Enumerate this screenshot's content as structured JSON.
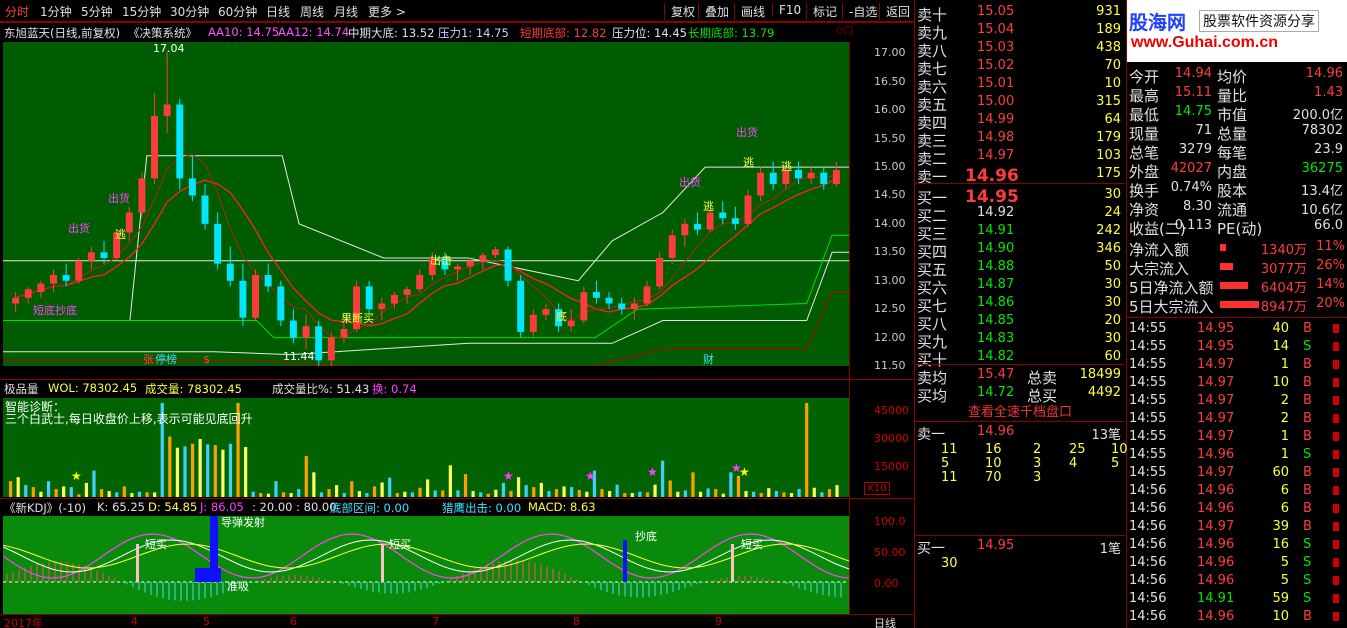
{
  "colors": {
    "up": "#ff3c3c",
    "down": "#00e6ff",
    "ma10": "#ffffff",
    "ma12": "#ff2020",
    "chart_bg": "#005c00",
    "vol_bg": "#006200",
    "kdj_bg": "#0a8a0a"
  },
  "toolbar": {
    "tabs": [
      "分时",
      "1分钟",
      "5分钟",
      "15分钟",
      "30分钟",
      "60分钟",
      "日线",
      "周线",
      "月线",
      "更多 >"
    ],
    "right": [
      "复权",
      "叠加",
      "画线",
      "F10",
      "标记",
      "-自选",
      "返回"
    ]
  },
  "info": {
    "stock": "东旭蓝天(日线,前复权)",
    "system": "《决策系统》",
    "ma10": "AA10: 14.75",
    "ma12": "AA12: 14.74",
    "mid_bottom": "中期大底: 13.52",
    "pressure": "压力1: 14.75",
    "short_bottom": "短期底部: 12.82",
    "pressure_level": "压力位: 14.45",
    "long_bottom": "长期底部: 13.79"
  },
  "chart_data": {
    "type": "candlestick",
    "yaxis_ticks": [
      "17.00",
      "16.50",
      "16.00",
      "15.50",
      "15.00",
      "14.50",
      "14.00",
      "13.50",
      "13.00",
      "12.50",
      "12.00",
      "11.50"
    ],
    "ylim": [
      11.5,
      17.2
    ],
    "annotations": [
      "17.04",
      "11.44",
      "出货",
      "出货",
      "出货",
      "出货",
      "逃",
      "逃",
      "逃",
      "逃",
      "出击",
      "底",
      "果断买",
      "短底抄底"
    ],
    "markers": [
      "张",
      "停榜",
      "$",
      "财"
    ],
    "candles": [
      {
        "o": 12.6,
        "h": 12.8,
        "l": 12.45,
        "c": 12.7
      },
      {
        "o": 12.7,
        "h": 12.9,
        "l": 12.6,
        "c": 12.85
      },
      {
        "o": 12.8,
        "h": 13.0,
        "l": 12.7,
        "c": 12.95
      },
      {
        "o": 12.95,
        "h": 13.2,
        "l": 12.8,
        "c": 13.1
      },
      {
        "o": 13.1,
        "h": 13.3,
        "l": 12.9,
        "c": 13.0
      },
      {
        "o": 13.0,
        "h": 13.4,
        "l": 12.95,
        "c": 13.35
      },
      {
        "o": 13.35,
        "h": 13.6,
        "l": 13.2,
        "c": 13.5
      },
      {
        "o": 13.5,
        "h": 13.7,
        "l": 13.3,
        "c": 13.4
      },
      {
        "o": 13.4,
        "h": 13.9,
        "l": 13.35,
        "c": 13.85
      },
      {
        "o": 13.85,
        "h": 14.3,
        "l": 13.7,
        "c": 14.2
      },
      {
        "o": 14.2,
        "h": 14.9,
        "l": 14.1,
        "c": 14.8
      },
      {
        "o": 14.8,
        "h": 16.3,
        "l": 14.7,
        "c": 15.9
      },
      {
        "o": 15.9,
        "h": 17.04,
        "l": 15.6,
        "c": 16.1
      },
      {
        "o": 16.1,
        "h": 16.2,
        "l": 14.6,
        "c": 14.8
      },
      {
        "o": 14.8,
        "h": 15.2,
        "l": 14.4,
        "c": 14.5
      },
      {
        "o": 14.5,
        "h": 14.7,
        "l": 13.9,
        "c": 14.0
      },
      {
        "o": 14.0,
        "h": 14.2,
        "l": 13.2,
        "c": 13.3
      },
      {
        "o": 13.3,
        "h": 13.6,
        "l": 12.9,
        "c": 13.0
      },
      {
        "o": 13.0,
        "h": 13.3,
        "l": 12.2,
        "c": 12.35
      },
      {
        "o": 12.35,
        "h": 13.2,
        "l": 12.3,
        "c": 13.1
      },
      {
        "o": 13.1,
        "h": 13.3,
        "l": 12.8,
        "c": 12.9
      },
      {
        "o": 12.9,
        "h": 13.0,
        "l": 12.2,
        "c": 12.3
      },
      {
        "o": 12.3,
        "h": 12.5,
        "l": 11.9,
        "c": 12.0
      },
      {
        "o": 12.0,
        "h": 12.4,
        "l": 11.8,
        "c": 12.2
      },
      {
        "o": 12.2,
        "h": 12.3,
        "l": 11.44,
        "c": 11.6
      },
      {
        "o": 11.6,
        "h": 12.1,
        "l": 11.5,
        "c": 12.0
      },
      {
        "o": 12.0,
        "h": 12.3,
        "l": 11.9,
        "c": 12.15
      },
      {
        "o": 12.15,
        "h": 13.0,
        "l": 12.1,
        "c": 12.9
      },
      {
        "o": 12.9,
        "h": 13.0,
        "l": 12.4,
        "c": 12.5
      },
      {
        "o": 12.5,
        "h": 12.7,
        "l": 12.3,
        "c": 12.6
      },
      {
        "o": 12.6,
        "h": 12.8,
        "l": 12.5,
        "c": 12.75
      },
      {
        "o": 12.75,
        "h": 12.9,
        "l": 12.6,
        "c": 12.85
      },
      {
        "o": 12.85,
        "h": 13.2,
        "l": 12.8,
        "c": 13.1
      },
      {
        "o": 13.1,
        "h": 13.5,
        "l": 13.0,
        "c": 13.4
      },
      {
        "o": 13.4,
        "h": 13.5,
        "l": 13.1,
        "c": 13.2
      },
      {
        "o": 13.2,
        "h": 13.3,
        "l": 13.0,
        "c": 13.25
      },
      {
        "o": 13.25,
        "h": 13.4,
        "l": 13.1,
        "c": 13.35
      },
      {
        "o": 13.35,
        "h": 13.5,
        "l": 13.2,
        "c": 13.45
      },
      {
        "o": 13.45,
        "h": 13.6,
        "l": 13.4,
        "c": 13.55
      },
      {
        "o": 13.55,
        "h": 13.6,
        "l": 12.9,
        "c": 13.0
      },
      {
        "o": 13.0,
        "h": 13.1,
        "l": 12.0,
        "c": 12.1
      },
      {
        "o": 12.1,
        "h": 12.5,
        "l": 12.0,
        "c": 12.4
      },
      {
        "o": 12.4,
        "h": 12.6,
        "l": 12.3,
        "c": 12.5
      },
      {
        "o": 12.5,
        "h": 12.6,
        "l": 12.1,
        "c": 12.2
      },
      {
        "o": 12.2,
        "h": 12.5,
        "l": 12.1,
        "c": 12.3
      },
      {
        "o": 12.3,
        "h": 12.9,
        "l": 12.25,
        "c": 12.8
      },
      {
        "o": 12.8,
        "h": 13.0,
        "l": 12.6,
        "c": 12.7
      },
      {
        "o": 12.7,
        "h": 12.8,
        "l": 12.5,
        "c": 12.6
      },
      {
        "o": 12.6,
        "h": 12.7,
        "l": 12.4,
        "c": 12.5
      },
      {
        "o": 12.5,
        "h": 12.7,
        "l": 12.3,
        "c": 12.6
      },
      {
        "o": 12.6,
        "h": 13.0,
        "l": 12.55,
        "c": 12.9
      },
      {
        "o": 12.9,
        "h": 13.5,
        "l": 12.85,
        "c": 13.4
      },
      {
        "o": 13.4,
        "h": 13.9,
        "l": 13.3,
        "c": 13.8
      },
      {
        "o": 13.8,
        "h": 14.1,
        "l": 13.6,
        "c": 14.0
      },
      {
        "o": 14.0,
        "h": 14.2,
        "l": 13.8,
        "c": 13.9
      },
      {
        "o": 13.9,
        "h": 14.3,
        "l": 13.85,
        "c": 14.2
      },
      {
        "o": 14.2,
        "h": 14.4,
        "l": 14.0,
        "c": 14.1
      },
      {
        "o": 14.1,
        "h": 14.3,
        "l": 13.9,
        "c": 14.0
      },
      {
        "o": 14.0,
        "h": 14.6,
        "l": 13.95,
        "c": 14.5
      },
      {
        "o": 14.5,
        "h": 15.0,
        "l": 14.4,
        "c": 14.9
      },
      {
        "o": 14.9,
        "h": 15.1,
        "l": 14.6,
        "c": 14.7
      },
      {
        "o": 14.7,
        "h": 15.0,
        "l": 14.6,
        "c": 14.95
      },
      {
        "o": 14.95,
        "h": 15.1,
        "l": 14.7,
        "c": 14.8
      },
      {
        "o": 14.8,
        "h": 15.0,
        "l": 14.7,
        "c": 14.9
      },
      {
        "o": 14.9,
        "h": 15.0,
        "l": 14.6,
        "c": 14.7
      },
      {
        "o": 14.7,
        "h": 15.1,
        "l": 14.65,
        "c": 14.95
      }
    ]
  },
  "volume": {
    "label": "极品量",
    "wol": "WOL: 78302.45",
    "vol": "成交量: 78302.45",
    "ratio": "成交量比%: 51.43",
    "turnover": "换: 0.74",
    "diag_title": "智能诊断：",
    "diag_text": "三个白武士,每日收盘价上移,表示可能见底回升",
    "ticks": [
      "45000",
      "30000",
      "15000"
    ],
    "multiplier": "X10"
  },
  "kdj": {
    "name": "《新KDJ》(-10)",
    "k": "K: 65.25",
    "d": "D: 54.85",
    "j": "J: 86.05",
    "levels": ": 20.00 : 80.00",
    "bottom_zone": "底部区间: 0.00",
    "hunter": "猎鹰出击: 0.00",
    "macd": "MACD: 8.63",
    "ticks": [
      "100.0",
      "50.00",
      "0.00"
    ],
    "labels": [
      "导弹发射",
      "短买",
      "短买",
      "抄底",
      "短买",
      "准吸"
    ]
  },
  "xaxis": {
    "labels": [
      "2017年",
      "4",
      "5",
      "6",
      "7",
      "8",
      "9"
    ],
    "period": "日线"
  },
  "orderbook": {
    "sells": [
      {
        "label": "卖十",
        "price": "15.05",
        "vol": "931"
      },
      {
        "label": "卖九",
        "price": "15.04",
        "vol": "189"
      },
      {
        "label": "卖八",
        "price": "15.03",
        "vol": "438"
      },
      {
        "label": "卖七",
        "price": "15.02",
        "vol": "70"
      },
      {
        "label": "卖六",
        "price": "15.01",
        "vol": "10"
      },
      {
        "label": "卖五",
        "price": "15.00",
        "vol": "315"
      },
      {
        "label": "卖四",
        "price": "14.99",
        "vol": "64"
      },
      {
        "label": "卖三",
        "price": "14.98",
        "vol": "179"
      },
      {
        "label": "卖二",
        "price": "14.97",
        "vol": "103"
      },
      {
        "label": "卖一",
        "price": "14.96",
        "vol": "175"
      }
    ],
    "buys": [
      {
        "label": "买一",
        "price": "14.95",
        "vol": "30"
      },
      {
        "label": "买二",
        "price": "14.92",
        "vol": "24"
      },
      {
        "label": "买三",
        "price": "14.91",
        "vol": "242"
      },
      {
        "label": "买四",
        "price": "14.90",
        "vol": "346"
      },
      {
        "label": "买五",
        "price": "14.88",
        "vol": "50"
      },
      {
        "label": "买六",
        "price": "14.87",
        "vol": "30"
      },
      {
        "label": "买七",
        "price": "14.86",
        "vol": "30"
      },
      {
        "label": "买八",
        "price": "14.85",
        "vol": "20"
      },
      {
        "label": "买九",
        "price": "14.83",
        "vol": "30"
      },
      {
        "label": "买十",
        "price": "14.82",
        "vol": "60"
      }
    ],
    "avg_sell_label": "卖均",
    "avg_sell": "15.47",
    "total_sell_label": "总卖",
    "total_sell": "18499",
    "avg_buy_label": "买均",
    "avg_buy": "14.72",
    "total_buy_label": "总买",
    "total_buy": "4492",
    "full_depth": "查看全速千档盘口",
    "sell1_label": "卖一",
    "sell1_price": "14.96",
    "sell1_count": "13笔",
    "sell1_queue": [
      [
        "11",
        "16",
        "2",
        "25",
        "10"
      ],
      [
        "5",
        "10",
        "3",
        "4",
        "5"
      ],
      [
        "11",
        "70",
        "3",
        "",
        ""
      ]
    ],
    "buy1_label": "买一",
    "buy1_price": "14.95",
    "buy1_count": "1笔",
    "buy1_queue": [
      "30"
    ]
  },
  "logo": {
    "main": "股海网",
    "sub": "股票软件资源分享",
    "url": "www.Guhai.com.cn"
  },
  "quote": [
    {
      "l1": "今开",
      "v1": "14.94",
      "c1": "red",
      "l2": "均价",
      "v2": "14.96",
      "c2": "red"
    },
    {
      "l1": "最高",
      "v1": "15.11",
      "c1": "red",
      "l2": "量比",
      "v2": "1.43",
      "c2": "red"
    },
    {
      "l1": "最低",
      "v1": "14.75",
      "c1": "green",
      "l2": "市值",
      "v2": "200.0亿",
      "c2": "white"
    },
    {
      "l1": "现量",
      "v1": "71",
      "c1": "white",
      "l2": "总量",
      "v2": "78302",
      "c2": "white"
    },
    {
      "l1": "总笔",
      "v1": "3279",
      "c1": "white",
      "l2": "每笔",
      "v2": "23.9",
      "c2": "white"
    },
    {
      "l1": "外盘",
      "v1": "42027",
      "c1": "red",
      "l2": "内盘",
      "v2": "36275",
      "c2": "green"
    },
    {
      "l1": "换手",
      "v1": "0.74%",
      "c1": "white",
      "l2": "股本",
      "v2": "13.4亿",
      "c2": "white"
    },
    {
      "l1": "净资",
      "v1": "8.30",
      "c1": "white",
      "l2": "流通",
      "v2": "10.6亿",
      "c2": "white"
    },
    {
      "l1": "收益(二)",
      "v1": "0.113",
      "c1": "white",
      "l2": "PE(动)",
      "v2": "66.0",
      "c2": "white"
    }
  ],
  "flows": [
    {
      "label": "净流入额",
      "amt": "1340万",
      "pct": "11%",
      "bar": 0.05
    },
    {
      "label": "大宗流入",
      "amt": "3077万",
      "pct": "26%",
      "bar": 0.12
    },
    {
      "label": "5日净流入额",
      "amt": "6404万",
      "pct": "14%",
      "bar": 0.25
    },
    {
      "label": "5日大宗流入",
      "amt": "8947万",
      "pct": "20%",
      "bar": 0.35
    }
  ],
  "ticks": [
    {
      "t": "14:55",
      "p": "14.95",
      "pc": "red",
      "v": "40",
      "s": "B"
    },
    {
      "t": "14:55",
      "p": "14.95",
      "pc": "red",
      "v": "14",
      "s": "S"
    },
    {
      "t": "14:55",
      "p": "14.97",
      "pc": "red",
      "v": "1",
      "s": "B"
    },
    {
      "t": "14:55",
      "p": "14.97",
      "pc": "red",
      "v": "10",
      "s": "B"
    },
    {
      "t": "14:55",
      "p": "14.97",
      "pc": "red",
      "v": "2",
      "s": "B"
    },
    {
      "t": "14:55",
      "p": "14.97",
      "pc": "red",
      "v": "2",
      "s": "B"
    },
    {
      "t": "14:55",
      "p": "14.97",
      "pc": "red",
      "v": "1",
      "s": "B"
    },
    {
      "t": "14:55",
      "p": "14.96",
      "pc": "red",
      "v": "1",
      "s": "S"
    },
    {
      "t": "14:55",
      "p": "14.97",
      "pc": "red",
      "v": "60",
      "s": "B"
    },
    {
      "t": "14:56",
      "p": "14.96",
      "pc": "red",
      "v": "6",
      "s": "B"
    },
    {
      "t": "14:56",
      "p": "14.96",
      "pc": "red",
      "v": "6",
      "s": "B"
    },
    {
      "t": "14:56",
      "p": "14.97",
      "pc": "red",
      "v": "39",
      "s": "B"
    },
    {
      "t": "14:56",
      "p": "14.96",
      "pc": "red",
      "v": "16",
      "s": "S"
    },
    {
      "t": "14:56",
      "p": "14.96",
      "pc": "red",
      "v": "5",
      "s": "S"
    },
    {
      "t": "14:56",
      "p": "14.96",
      "pc": "red",
      "v": "5",
      "s": "S"
    },
    {
      "t": "14:56",
      "p": "14.91",
      "pc": "green",
      "v": "59",
      "s": "S"
    },
    {
      "t": "14:56",
      "p": "14.96",
      "pc": "red",
      "v": "10",
      "s": "B"
    }
  ]
}
